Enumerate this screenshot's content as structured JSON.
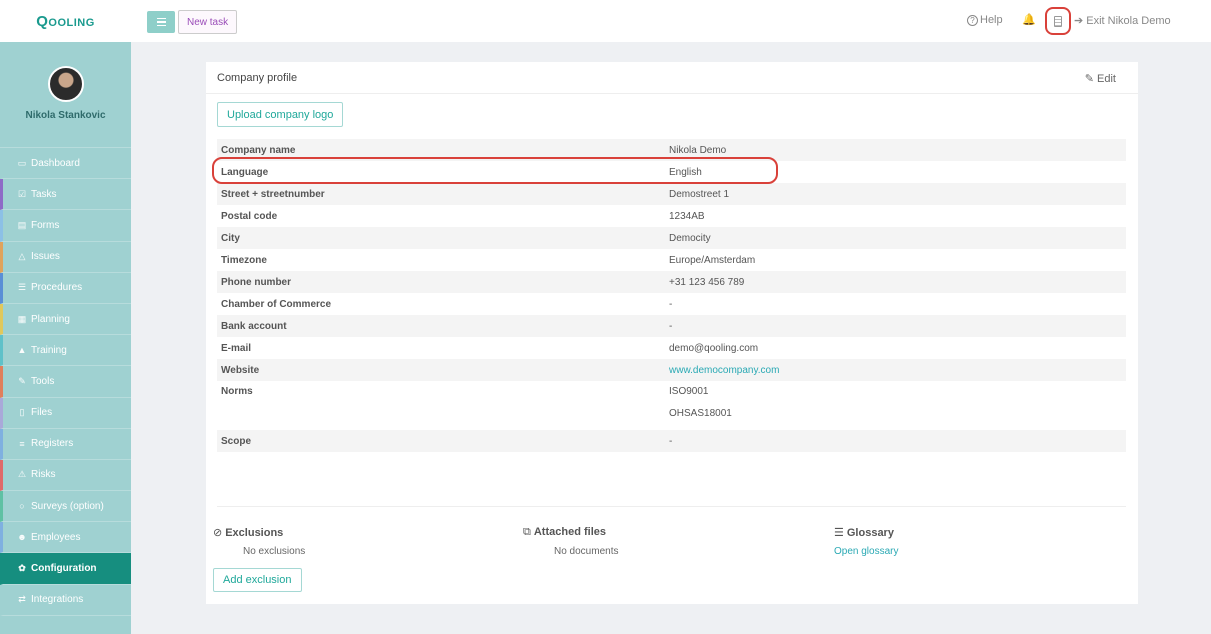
{
  "app": {
    "logo": "Qooling"
  },
  "user": {
    "name": "Nikola Stankovic"
  },
  "sidebar": {
    "items": [
      {
        "label": "Dashboard",
        "icon": "▭"
      },
      {
        "label": "Tasks",
        "icon": "☑"
      },
      {
        "label": "Forms",
        "icon": "▤"
      },
      {
        "label": "Issues",
        "icon": "△"
      },
      {
        "label": "Procedures",
        "icon": "☰"
      },
      {
        "label": "Planning",
        "icon": "▦"
      },
      {
        "label": "Training",
        "icon": "▲"
      },
      {
        "label": "Tools",
        "icon": "✎"
      },
      {
        "label": "Files",
        "icon": "▯"
      },
      {
        "label": "Registers",
        "icon": "≡"
      },
      {
        "label": "Risks",
        "icon": "⚠"
      },
      {
        "label": "Surveys (option)",
        "icon": "○"
      },
      {
        "label": "Employees",
        "icon": "☻"
      },
      {
        "label": "Configuration",
        "icon": "✿"
      },
      {
        "label": "Integrations",
        "icon": "⇄"
      }
    ],
    "accents": [
      "#9fd1d1",
      "#8e6bc7",
      "#8cc0e6",
      "#e0a35c",
      "#5a8fd6",
      "#e0c85c",
      "#5fc1c9",
      "#e07f5c",
      "#a9a9d9",
      "#7fb0e0",
      "#e06a6a",
      "#5fc1a4",
      "#7fb0e0",
      "#168e7f",
      "#9fd1d1"
    ]
  },
  "topbar": {
    "new_task": "New task",
    "help": "Help",
    "exit": "Exit Nikola Demo"
  },
  "card": {
    "title": "Company profile",
    "edit": "Edit",
    "upload_logo": "Upload company logo",
    "fields": {
      "company_name": {
        "label": "Company name",
        "value": "Nikola Demo"
      },
      "language": {
        "label": "Language",
        "value": "English"
      },
      "street": {
        "label": "Street + streetnumber",
        "value": "Demostreet 1"
      },
      "postal": {
        "label": "Postal code",
        "value": "1234AB"
      },
      "city": {
        "label": "City",
        "value": "Democity"
      },
      "timezone": {
        "label": "Timezone",
        "value": "Europe/Amsterdam"
      },
      "phone": {
        "label": "Phone number",
        "value": "+31 123 456 789"
      },
      "chamber": {
        "label": "Chamber of Commerce",
        "value": "-"
      },
      "bank": {
        "label": "Bank account",
        "value": "-"
      },
      "email": {
        "label": "E-mail",
        "value": "demo@qooling.com"
      },
      "website": {
        "label": "Website",
        "value": "www.democompany.com"
      },
      "norms": {
        "label": "Norms",
        "values": [
          "ISO9001",
          "OHSAS18001"
        ]
      },
      "scope": {
        "label": "Scope",
        "value": "-"
      }
    },
    "exclusions": {
      "title": "Exclusions",
      "empty": "No exclusions",
      "add": "Add exclusion"
    },
    "attached": {
      "title": "Attached files",
      "empty": "No documents"
    },
    "glossary": {
      "title": "Glossary",
      "link": "Open glossary"
    }
  },
  "colors": {
    "accent": "#168e7f",
    "sidebar": "#9fd1d1",
    "highlight": "#d9413a",
    "link": "#2aa9b4"
  }
}
